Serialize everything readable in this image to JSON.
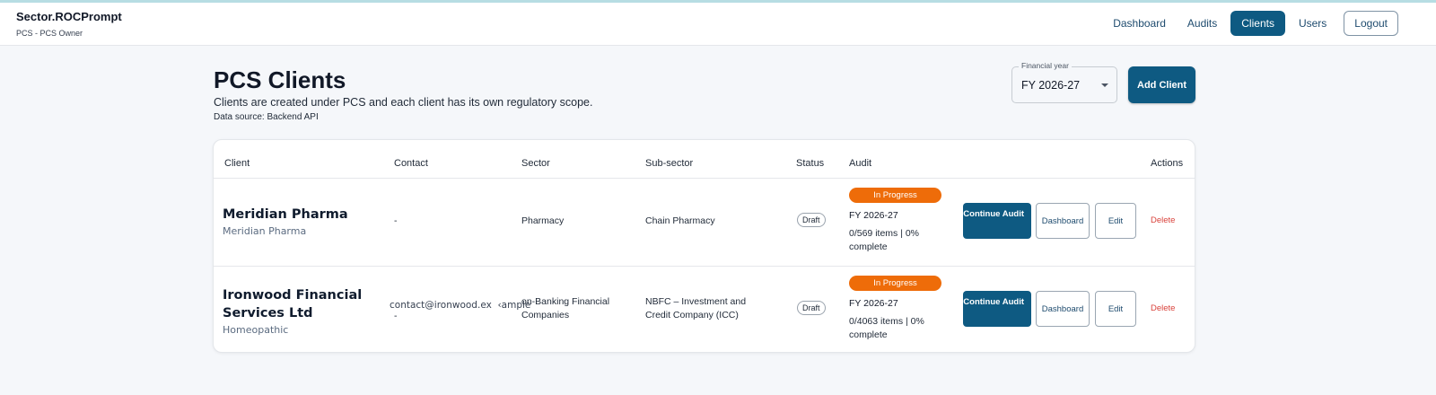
{
  "app": {
    "brand": "Sector.ROCPrompt",
    "subtitle": "PCS - PCS Owner"
  },
  "nav": {
    "dashboard": "Dashboard",
    "audits": "Audits",
    "clients": "Clients",
    "users": "Users",
    "logout": "Logout"
  },
  "page": {
    "title": "PCS Clients",
    "description": "Clients are created under PCS and each client has its own regulatory scope.",
    "source": "Data source: Backend API"
  },
  "financial_year": {
    "label": "Financial year",
    "value": "FY 2026-27"
  },
  "add_client": "Add Client",
  "table": {
    "headers": [
      "Client",
      "Contact",
      "Sector",
      "Sub-sector",
      "Status",
      "Audit",
      "Actions"
    ],
    "rows": [
      {
        "name": "Meridian Pharma",
        "name_sub": "Meridian Pharma",
        "contact": "-",
        "contact_email": "",
        "sector": "Pharmacy",
        "subsector": "Chain Pharmacy",
        "status": "Draft",
        "audit_status": "In Progress",
        "audit_fy": "FY 2026-27",
        "audit_items": "0/569 items | 0% complete",
        "btn_continue": "Continue Audit",
        "btn_dashboard": "Dashboard",
        "btn_edit": "Edit",
        "btn_delete": "Delete"
      },
      {
        "name": "Ironwood Financial Services Ltd",
        "name_sub": "Homeopathic",
        "contact": "-",
        "contact_email": "contact@ironwood.ex  ‹ample",
        "sector": "on-Banking Financial Companies",
        "subsector": "NBFC – Investment and Credit Company (ICC)",
        "status": "Draft",
        "audit_status": "In Progress",
        "audit_fy": "FY 2026-27",
        "audit_items": "0/4063 items | 0% complete",
        "btn_continue": "Continue Audit",
        "btn_dashboard": "Dashboard",
        "btn_edit": "Edit",
        "btn_delete": "Delete"
      }
    ]
  }
}
